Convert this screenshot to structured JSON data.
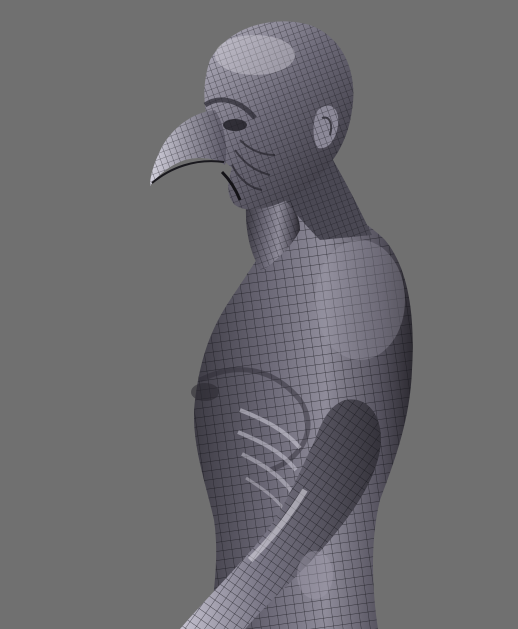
{
  "viewport": {
    "background_color": "#707070",
    "model": {
      "subject": "beaked-creature-sculpt",
      "view": "side-profile",
      "shading": "matcap-grey",
      "wireframe": true,
      "base_color": "#5a5862",
      "highlight_color": "#c9c7d2",
      "shadow_color": "#24222a",
      "wire_color": "#0f0f12"
    }
  }
}
